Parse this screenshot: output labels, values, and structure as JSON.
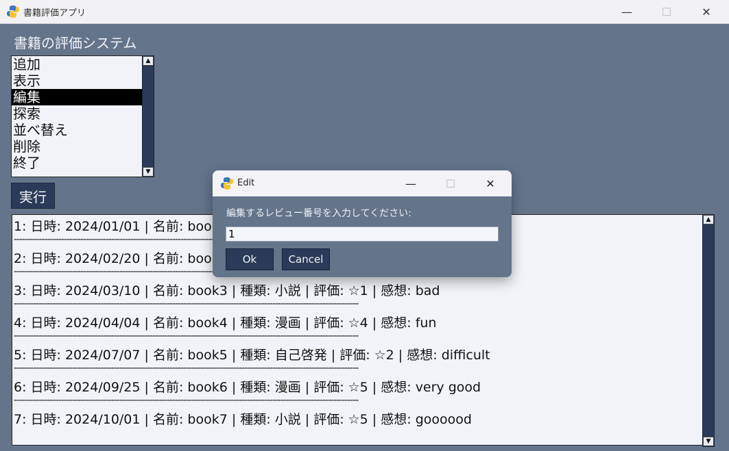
{
  "window": {
    "title": "書籍評価アプリ",
    "minimize": "—",
    "maximize": "☐",
    "close": "✕"
  },
  "main": {
    "heading": "書籍の評価システム",
    "menu_items": [
      "追加",
      "表示",
      "編集",
      "探索",
      "並べ替え",
      "削除",
      "終了"
    ],
    "selected_index": 2,
    "execute_label": "実行"
  },
  "records": [
    "1: 日時: 2024/01/01 | 名前: book1 | 種類: 小説 | 評価: ☆3 | 感想: good",
    "2: 日時: 2024/02/20 | 名前: book2 | 種類: 漫画 | 評価: ☆3 | 感想: normal",
    "3: 日時: 2024/03/10 | 名前: book3 | 種類: 小説 | 評価: ☆1 | 感想: bad",
    "4: 日時: 2024/04/04 | 名前: book4 | 種類: 漫画 | 評価: ☆4 | 感想: fun",
    "5: 日時: 2024/07/07 | 名前: book5 | 種類: 自己啓発 | 評価: ☆2 | 感想: difficult",
    "6: 日時: 2024/09/25 | 名前: book6 | 種類: 漫画 | 評価: ☆5 | 感想: very good",
    "7: 日時: 2024/10/01 | 名前: book7 | 種類: 小説 | 評価: ☆5 | 感想: goooood"
  ],
  "separator": "----------------------------------------------------------------------------------------------------------------------------",
  "dialog": {
    "title": "Edit",
    "minimize": "—",
    "maximize": "☐",
    "close": "✕",
    "prompt": "編集するレビュー番号を入力してください:",
    "input_value": "1",
    "ok_label": "Ok",
    "cancel_label": "Cancel"
  },
  "colors": {
    "background": "#64748b",
    "button": "#2b3a58",
    "list_background": "#f1f3f8"
  }
}
